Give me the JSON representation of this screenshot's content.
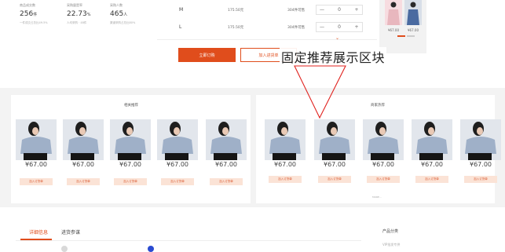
{
  "stats": [
    {
      "label": "商品成交数",
      "value": "256",
      "unit": "件",
      "sub": "一件成交占总比49.5%"
    },
    {
      "label": "采购量是率",
      "value": "22.73",
      "unit": "%",
      "sub": "人均采购 · 48件"
    },
    {
      "label": "采购人数",
      "value": "465",
      "unit": "人",
      "sub": "渠道采购占总比80%"
    }
  ],
  "sizes": [
    {
      "size": "M",
      "price": "175.50元",
      "stock": "304件可售",
      "qty": "0"
    },
    {
      "size": "L",
      "price": "175.50元",
      "stock": "304件可售",
      "qty": "0"
    }
  ],
  "thumbnails_top": [
    {
      "price": "¥67.00"
    },
    {
      "price": "¥67.00"
    }
  ],
  "buttons": {
    "order": "立即订购",
    "add_to_order": "加入进货单",
    "stepper_minus": "—",
    "stepper_plus": "+"
  },
  "annotation": "固定推荐展示区块",
  "related": {
    "title": "相关推荐",
    "items": [
      {
        "price": "¥67.00",
        "button": "加入订货单"
      },
      {
        "price": "¥67.00",
        "button": "加入订货单"
      },
      {
        "price": "¥67.00",
        "button": "加入订货单"
      },
      {
        "price": "¥67.00",
        "button": "加入订货单"
      },
      {
        "price": "¥67.00",
        "button": "加入订货单"
      }
    ]
  },
  "hot": {
    "title": "商家热荐",
    "items": [
      {
        "price": "¥67.00",
        "button": "加入订货单"
      },
      {
        "price": "¥67.00",
        "button": "加入订货单"
      },
      {
        "price": "¥67.00",
        "button": "加入订货单"
      },
      {
        "price": "¥67.00",
        "button": "加入订货单"
      },
      {
        "price": "¥67.00",
        "button": "加入订货单"
      }
    ],
    "more": "MORE..."
  },
  "tabs": [
    {
      "label": "详细信息",
      "active": true
    },
    {
      "label": "进货参谋",
      "active": false
    }
  ],
  "side": {
    "title": "产品分类",
    "sub": "VIP批发专供"
  },
  "colors": {
    "accent": "#e04d1c",
    "add_button_bg": "#fbe3d6",
    "shirt": "#9fb0c8"
  }
}
